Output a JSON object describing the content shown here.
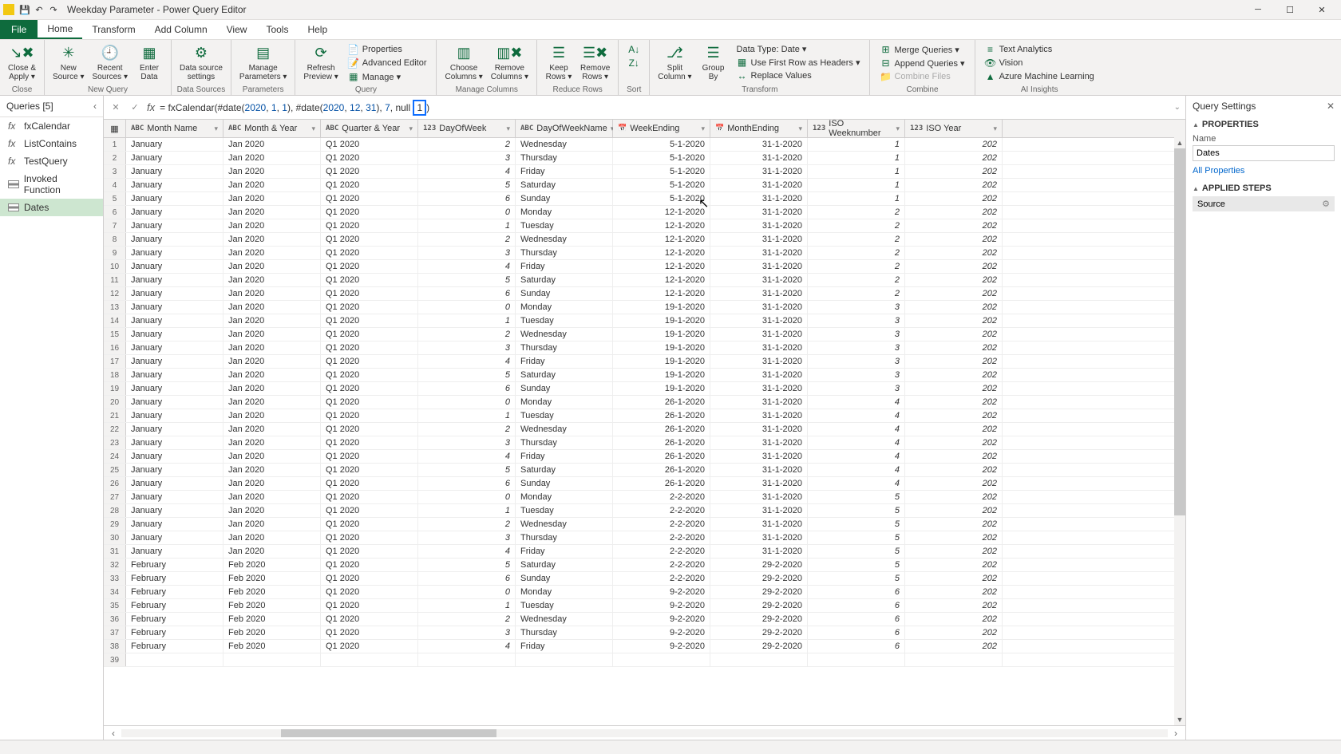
{
  "window": {
    "title": "Weekday Parameter - Power Query Editor"
  },
  "menu": {
    "file": "File",
    "tabs": [
      "Home",
      "Transform",
      "Add Column",
      "View",
      "Tools",
      "Help"
    ],
    "active": 0
  },
  "ribbon": {
    "close": {
      "label": "Close &\nApply ▾",
      "group": "Close"
    },
    "newquery": {
      "new_source": "New\nSource ▾",
      "recent": "Recent\nSources ▾",
      "enter": "Enter\nData",
      "group": "New Query"
    },
    "datasources": {
      "settings": "Data source\nsettings",
      "group": "Data Sources"
    },
    "parameters": {
      "manage": "Manage\nParameters ▾",
      "group": "Parameters"
    },
    "query": {
      "refresh": "Refresh\nPreview ▾",
      "props": "Properties",
      "adv": "Advanced Editor",
      "mng": "Manage ▾",
      "group": "Query"
    },
    "managecols": {
      "choose": "Choose\nColumns ▾",
      "remove": "Remove\nColumns ▾",
      "group": "Manage Columns"
    },
    "reducerows": {
      "keep": "Keep\nRows ▾",
      "removerows": "Remove\nRows ▾",
      "group": "Reduce Rows"
    },
    "sort": {
      "group": "Sort"
    },
    "transform": {
      "split": "Split\nColumn ▾",
      "groupby": "Group\nBy",
      "datatype": "Data Type: Date ▾",
      "firstrow": "Use First Row as Headers ▾",
      "replace": "Replace Values",
      "group": "Transform"
    },
    "combine": {
      "merge": "Merge Queries ▾",
      "append": "Append Queries ▾",
      "combinefiles": "Combine Files",
      "group": "Combine"
    },
    "ai": {
      "text": "Text Analytics",
      "vision": "Vision",
      "ml": "Azure Machine Learning",
      "group": "AI Insights"
    }
  },
  "queries": {
    "header": "Queries [5]",
    "items": [
      {
        "name": "fxCalendar",
        "icon": "fx"
      },
      {
        "name": "ListContains",
        "icon": "fx"
      },
      {
        "name": "TestQuery",
        "icon": "fx"
      },
      {
        "name": "Invoked Function",
        "icon": "table"
      },
      {
        "name": "Dates",
        "icon": "table",
        "selected": true
      }
    ]
  },
  "formula": {
    "prefix": "= fxCalendar(#date(",
    "d1a": "2020",
    "d1b": ", ",
    "d1c": "1",
    "d1d": ", ",
    "d1e": "1",
    "mid": "), #date(",
    "d2a": "2020",
    "d2b": ", ",
    "d2c": "12",
    "d2d": ", ",
    "d2e": "31",
    "tail1": "), ",
    "p1": "7",
    "tail2": ", ",
    "p2": "null",
    "tail3": " ",
    "sel": "1",
    "tail4": ")"
  },
  "columns": [
    {
      "key": "month",
      "label": "Month Name",
      "type": "ABC"
    },
    {
      "key": "monthyear",
      "label": "Month & Year",
      "type": "ABC"
    },
    {
      "key": "qy",
      "label": "Quarter & Year",
      "type": "ABC"
    },
    {
      "key": "dow",
      "label": "DayOfWeek",
      "type": "123"
    },
    {
      "key": "downame",
      "label": "DayOfWeekName",
      "type": "ABC"
    },
    {
      "key": "we",
      "label": "WeekEnding",
      "type": "📅"
    },
    {
      "key": "me",
      "label": "MonthEnding",
      "type": "📅"
    },
    {
      "key": "isow",
      "label": "ISO Weeknumber",
      "type": "123"
    },
    {
      "key": "isoy",
      "label": "ISO Year",
      "type": "123"
    }
  ],
  "rows": [
    {
      "n": 1,
      "month": "January",
      "my": "Jan 2020",
      "qy": "Q1 2020",
      "dow": "2",
      "dn": "Wednesday",
      "we": "5-1-2020",
      "me": "31-1-2020",
      "iw": "1",
      "iy": "202"
    },
    {
      "n": 2,
      "month": "January",
      "my": "Jan 2020",
      "qy": "Q1 2020",
      "dow": "3",
      "dn": "Thursday",
      "we": "5-1-2020",
      "me": "31-1-2020",
      "iw": "1",
      "iy": "202"
    },
    {
      "n": 3,
      "month": "January",
      "my": "Jan 2020",
      "qy": "Q1 2020",
      "dow": "4",
      "dn": "Friday",
      "we": "5-1-2020",
      "me": "31-1-2020",
      "iw": "1",
      "iy": "202"
    },
    {
      "n": 4,
      "month": "January",
      "my": "Jan 2020",
      "qy": "Q1 2020",
      "dow": "5",
      "dn": "Saturday",
      "we": "5-1-2020",
      "me": "31-1-2020",
      "iw": "1",
      "iy": "202"
    },
    {
      "n": 5,
      "month": "January",
      "my": "Jan 2020",
      "qy": "Q1 2020",
      "dow": "6",
      "dn": "Sunday",
      "we": "5-1-2020",
      "me": "31-1-2020",
      "iw": "1",
      "iy": "202"
    },
    {
      "n": 6,
      "month": "January",
      "my": "Jan 2020",
      "qy": "Q1 2020",
      "dow": "0",
      "dn": "Monday",
      "we": "12-1-2020",
      "me": "31-1-2020",
      "iw": "2",
      "iy": "202"
    },
    {
      "n": 7,
      "month": "January",
      "my": "Jan 2020",
      "qy": "Q1 2020",
      "dow": "1",
      "dn": "Tuesday",
      "we": "12-1-2020",
      "me": "31-1-2020",
      "iw": "2",
      "iy": "202"
    },
    {
      "n": 8,
      "month": "January",
      "my": "Jan 2020",
      "qy": "Q1 2020",
      "dow": "2",
      "dn": "Wednesday",
      "we": "12-1-2020",
      "me": "31-1-2020",
      "iw": "2",
      "iy": "202"
    },
    {
      "n": 9,
      "month": "January",
      "my": "Jan 2020",
      "qy": "Q1 2020",
      "dow": "3",
      "dn": "Thursday",
      "we": "12-1-2020",
      "me": "31-1-2020",
      "iw": "2",
      "iy": "202"
    },
    {
      "n": 10,
      "month": "January",
      "my": "Jan 2020",
      "qy": "Q1 2020",
      "dow": "4",
      "dn": "Friday",
      "we": "12-1-2020",
      "me": "31-1-2020",
      "iw": "2",
      "iy": "202"
    },
    {
      "n": 11,
      "month": "January",
      "my": "Jan 2020",
      "qy": "Q1 2020",
      "dow": "5",
      "dn": "Saturday",
      "we": "12-1-2020",
      "me": "31-1-2020",
      "iw": "2",
      "iy": "202"
    },
    {
      "n": 12,
      "month": "January",
      "my": "Jan 2020",
      "qy": "Q1 2020",
      "dow": "6",
      "dn": "Sunday",
      "we": "12-1-2020",
      "me": "31-1-2020",
      "iw": "2",
      "iy": "202"
    },
    {
      "n": 13,
      "month": "January",
      "my": "Jan 2020",
      "qy": "Q1 2020",
      "dow": "0",
      "dn": "Monday",
      "we": "19-1-2020",
      "me": "31-1-2020",
      "iw": "3",
      "iy": "202"
    },
    {
      "n": 14,
      "month": "January",
      "my": "Jan 2020",
      "qy": "Q1 2020",
      "dow": "1",
      "dn": "Tuesday",
      "we": "19-1-2020",
      "me": "31-1-2020",
      "iw": "3",
      "iy": "202"
    },
    {
      "n": 15,
      "month": "January",
      "my": "Jan 2020",
      "qy": "Q1 2020",
      "dow": "2",
      "dn": "Wednesday",
      "we": "19-1-2020",
      "me": "31-1-2020",
      "iw": "3",
      "iy": "202"
    },
    {
      "n": 16,
      "month": "January",
      "my": "Jan 2020",
      "qy": "Q1 2020",
      "dow": "3",
      "dn": "Thursday",
      "we": "19-1-2020",
      "me": "31-1-2020",
      "iw": "3",
      "iy": "202"
    },
    {
      "n": 17,
      "month": "January",
      "my": "Jan 2020",
      "qy": "Q1 2020",
      "dow": "4",
      "dn": "Friday",
      "we": "19-1-2020",
      "me": "31-1-2020",
      "iw": "3",
      "iy": "202"
    },
    {
      "n": 18,
      "month": "January",
      "my": "Jan 2020",
      "qy": "Q1 2020",
      "dow": "5",
      "dn": "Saturday",
      "we": "19-1-2020",
      "me": "31-1-2020",
      "iw": "3",
      "iy": "202"
    },
    {
      "n": 19,
      "month": "January",
      "my": "Jan 2020",
      "qy": "Q1 2020",
      "dow": "6",
      "dn": "Sunday",
      "we": "19-1-2020",
      "me": "31-1-2020",
      "iw": "3",
      "iy": "202"
    },
    {
      "n": 20,
      "month": "January",
      "my": "Jan 2020",
      "qy": "Q1 2020",
      "dow": "0",
      "dn": "Monday",
      "we": "26-1-2020",
      "me": "31-1-2020",
      "iw": "4",
      "iy": "202"
    },
    {
      "n": 21,
      "month": "January",
      "my": "Jan 2020",
      "qy": "Q1 2020",
      "dow": "1",
      "dn": "Tuesday",
      "we": "26-1-2020",
      "me": "31-1-2020",
      "iw": "4",
      "iy": "202"
    },
    {
      "n": 22,
      "month": "January",
      "my": "Jan 2020",
      "qy": "Q1 2020",
      "dow": "2",
      "dn": "Wednesday",
      "we": "26-1-2020",
      "me": "31-1-2020",
      "iw": "4",
      "iy": "202"
    },
    {
      "n": 23,
      "month": "January",
      "my": "Jan 2020",
      "qy": "Q1 2020",
      "dow": "3",
      "dn": "Thursday",
      "we": "26-1-2020",
      "me": "31-1-2020",
      "iw": "4",
      "iy": "202"
    },
    {
      "n": 24,
      "month": "January",
      "my": "Jan 2020",
      "qy": "Q1 2020",
      "dow": "4",
      "dn": "Friday",
      "we": "26-1-2020",
      "me": "31-1-2020",
      "iw": "4",
      "iy": "202"
    },
    {
      "n": 25,
      "month": "January",
      "my": "Jan 2020",
      "qy": "Q1 2020",
      "dow": "5",
      "dn": "Saturday",
      "we": "26-1-2020",
      "me": "31-1-2020",
      "iw": "4",
      "iy": "202"
    },
    {
      "n": 26,
      "month": "January",
      "my": "Jan 2020",
      "qy": "Q1 2020",
      "dow": "6",
      "dn": "Sunday",
      "we": "26-1-2020",
      "me": "31-1-2020",
      "iw": "4",
      "iy": "202"
    },
    {
      "n": 27,
      "month": "January",
      "my": "Jan 2020",
      "qy": "Q1 2020",
      "dow": "0",
      "dn": "Monday",
      "we": "2-2-2020",
      "me": "31-1-2020",
      "iw": "5",
      "iy": "202"
    },
    {
      "n": 28,
      "month": "January",
      "my": "Jan 2020",
      "qy": "Q1 2020",
      "dow": "1",
      "dn": "Tuesday",
      "we": "2-2-2020",
      "me": "31-1-2020",
      "iw": "5",
      "iy": "202"
    },
    {
      "n": 29,
      "month": "January",
      "my": "Jan 2020",
      "qy": "Q1 2020",
      "dow": "2",
      "dn": "Wednesday",
      "we": "2-2-2020",
      "me": "31-1-2020",
      "iw": "5",
      "iy": "202"
    },
    {
      "n": 30,
      "month": "January",
      "my": "Jan 2020",
      "qy": "Q1 2020",
      "dow": "3",
      "dn": "Thursday",
      "we": "2-2-2020",
      "me": "31-1-2020",
      "iw": "5",
      "iy": "202"
    },
    {
      "n": 31,
      "month": "January",
      "my": "Jan 2020",
      "qy": "Q1 2020",
      "dow": "4",
      "dn": "Friday",
      "we": "2-2-2020",
      "me": "31-1-2020",
      "iw": "5",
      "iy": "202"
    },
    {
      "n": 32,
      "month": "February",
      "my": "Feb 2020",
      "qy": "Q1 2020",
      "dow": "5",
      "dn": "Saturday",
      "we": "2-2-2020",
      "me": "29-2-2020",
      "iw": "5",
      "iy": "202"
    },
    {
      "n": 33,
      "month": "February",
      "my": "Feb 2020",
      "qy": "Q1 2020",
      "dow": "6",
      "dn": "Sunday",
      "we": "2-2-2020",
      "me": "29-2-2020",
      "iw": "5",
      "iy": "202"
    },
    {
      "n": 34,
      "month": "February",
      "my": "Feb 2020",
      "qy": "Q1 2020",
      "dow": "0",
      "dn": "Monday",
      "we": "9-2-2020",
      "me": "29-2-2020",
      "iw": "6",
      "iy": "202"
    },
    {
      "n": 35,
      "month": "February",
      "my": "Feb 2020",
      "qy": "Q1 2020",
      "dow": "1",
      "dn": "Tuesday",
      "we": "9-2-2020",
      "me": "29-2-2020",
      "iw": "6",
      "iy": "202"
    },
    {
      "n": 36,
      "month": "February",
      "my": "Feb 2020",
      "qy": "Q1 2020",
      "dow": "2",
      "dn": "Wednesday",
      "we": "9-2-2020",
      "me": "29-2-2020",
      "iw": "6",
      "iy": "202"
    },
    {
      "n": 37,
      "month": "February",
      "my": "Feb 2020",
      "qy": "Q1 2020",
      "dow": "3",
      "dn": "Thursday",
      "we": "9-2-2020",
      "me": "29-2-2020",
      "iw": "6",
      "iy": "202"
    },
    {
      "n": 38,
      "month": "February",
      "my": "Feb 2020",
      "qy": "Q1 2020",
      "dow": "4",
      "dn": "Friday",
      "we": "9-2-2020",
      "me": "29-2-2020",
      "iw": "6",
      "iy": "202"
    },
    {
      "n": 39,
      "month": "",
      "my": "",
      "qy": "",
      "dow": "",
      "dn": "",
      "we": "",
      "me": "",
      "iw": "",
      "iy": ""
    }
  ],
  "settings": {
    "title": "Query Settings",
    "properties": "PROPERTIES",
    "name_label": "Name",
    "name_value": "Dates",
    "all_props": "All Properties",
    "applied": "APPLIED STEPS",
    "step": "Source"
  }
}
